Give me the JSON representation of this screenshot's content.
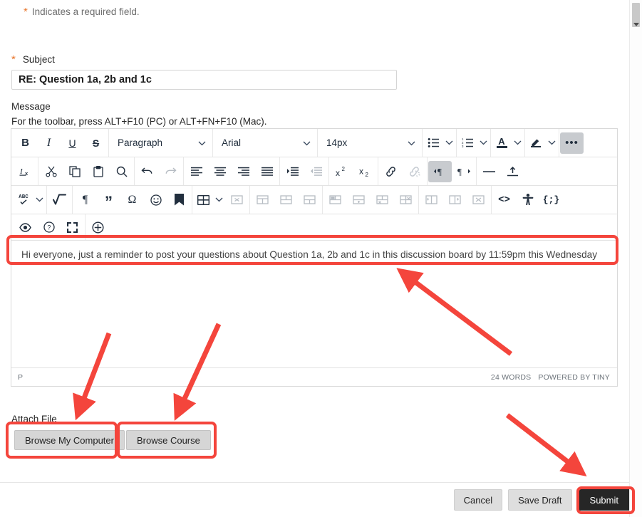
{
  "form": {
    "required_note": "Indicates a required field.",
    "required_marker": "*",
    "subject": {
      "label": "Subject",
      "value": "RE: Question 1a, 2b and 1c",
      "placeholder": "Subject"
    },
    "message": {
      "label": "Message",
      "hint": "For the toolbar, press ALT+F10 (PC) or ALT+FN+F10 (Mac).",
      "body": "Hi everyone, just a reminder to post your questions about Question 1a, 2b and 1c in this discussion board by 11:59pm this Wednesday"
    },
    "attach": {
      "label": "Attach File",
      "browse_my_computer": "Browse My Computer",
      "browse_course": "Browse Course"
    }
  },
  "editor": {
    "selects": {
      "block_format": "Paragraph",
      "font_family": "Arial",
      "font_size": "14px"
    },
    "status": {
      "path": "P",
      "word_count": "24 WORDS",
      "branding": "POWERED BY TINY"
    },
    "toolbar_rows": [
      {
        "groups": [
          {
            "items": [
              {
                "name": "bold-icon",
                "label": "B"
              },
              {
                "name": "italic-icon",
                "label": "I"
              },
              {
                "name": "underline-icon",
                "label": "U"
              },
              {
                "name": "strikethrough-icon",
                "label": "S"
              }
            ]
          },
          {
            "items": [
              {
                "name": "block-format-select",
                "label": "Paragraph"
              }
            ]
          },
          {
            "items": [
              {
                "name": "font-family-select",
                "label": "Arial"
              }
            ]
          },
          {
            "items": [
              {
                "name": "font-size-select",
                "label": "14px"
              }
            ]
          },
          {
            "items": [
              {
                "name": "bullet-list-icon",
                "label": ""
              }
            ]
          },
          {
            "items": [
              {
                "name": "numbered-list-icon",
                "label": ""
              }
            ]
          },
          {
            "items": [
              {
                "name": "text-color-icon",
                "label": "A"
              }
            ]
          },
          {
            "items": [
              {
                "name": "highlight-color-icon",
                "label": ""
              }
            ]
          },
          {
            "items": [
              {
                "name": "more-options-icon",
                "label": "•••"
              }
            ]
          }
        ]
      },
      {
        "groups": [
          {
            "items": [
              {
                "name": "clear-formatting-icon",
                "label": ""
              }
            ]
          },
          {
            "items": [
              {
                "name": "cut-icon",
                "label": ""
              },
              {
                "name": "copy-icon",
                "label": ""
              },
              {
                "name": "paste-icon",
                "label": ""
              },
              {
                "name": "find-replace-icon",
                "label": ""
              }
            ]
          },
          {
            "items": [
              {
                "name": "undo-icon",
                "label": ""
              },
              {
                "name": "redo-icon",
                "label": ""
              }
            ]
          },
          {
            "items": [
              {
                "name": "align-left-icon",
                "label": ""
              },
              {
                "name": "align-center-icon",
                "label": ""
              },
              {
                "name": "align-right-icon",
                "label": ""
              },
              {
                "name": "align-justify-icon",
                "label": ""
              }
            ]
          },
          {
            "items": [
              {
                "name": "indent-increase-icon",
                "label": ""
              },
              {
                "name": "indent-decrease-icon",
                "label": ""
              }
            ]
          },
          {
            "items": [
              {
                "name": "superscript-icon",
                "label": ""
              },
              {
                "name": "subscript-icon",
                "label": ""
              }
            ]
          },
          {
            "items": [
              {
                "name": "insert-link-icon",
                "label": ""
              },
              {
                "name": "unlink-icon",
                "label": ""
              }
            ]
          },
          {
            "items": [
              {
                "name": "ltr-direction-icon",
                "label": ""
              },
              {
                "name": "rtl-direction-icon",
                "label": ""
              }
            ]
          },
          {
            "items": [
              {
                "name": "horizontal-rule-icon",
                "label": ""
              },
              {
                "name": "page-break-icon",
                "label": ""
              }
            ]
          }
        ]
      },
      {
        "groups": [
          {
            "items": [
              {
                "name": "spellcheck-icon",
                "label": "ABC"
              }
            ]
          },
          {
            "items": [
              {
                "name": "math-equation-icon",
                "label": ""
              }
            ]
          },
          {
            "items": [
              {
                "name": "show-invisible-chars-icon",
                "label": "¶"
              },
              {
                "name": "blockquote-icon",
                "label": "”"
              },
              {
                "name": "special-character-icon",
                "label": "Ω"
              },
              {
                "name": "emoji-icon",
                "label": ""
              },
              {
                "name": "anchor-icon",
                "label": ""
              }
            ]
          },
          {
            "items": [
              {
                "name": "insert-table-icon",
                "label": ""
              },
              {
                "name": "delete-table-icon",
                "label": ""
              }
            ]
          },
          {
            "items": [
              {
                "name": "table-properties-icon",
                "label": ""
              },
              {
                "name": "table-cell-properties-icon",
                "label": ""
              },
              {
                "name": "merge-cells-icon",
                "label": ""
              }
            ]
          },
          {
            "items": [
              {
                "name": "insert-row-before-icon",
                "label": ""
              },
              {
                "name": "insert-row-after-icon",
                "label": ""
              },
              {
                "name": "delete-row-icon",
                "label": ""
              },
              {
                "name": "delete-column-icon",
                "label": ""
              }
            ]
          },
          {
            "items": [
              {
                "name": "insert-column-before-icon",
                "label": ""
              },
              {
                "name": "insert-column-after-icon",
                "label": ""
              },
              {
                "name": "delete-table-column-icon",
                "label": ""
              }
            ]
          },
          {
            "items": [
              {
                "name": "source-code-icon",
                "label": "<>"
              },
              {
                "name": "accessibility-checker-icon",
                "label": ""
              },
              {
                "name": "code-sample-icon",
                "label": "{;}"
              }
            ]
          }
        ]
      },
      {
        "groups": [
          {
            "items": [
              {
                "name": "preview-icon",
                "label": ""
              },
              {
                "name": "help-icon",
                "label": "?"
              },
              {
                "name": "fullscreen-icon",
                "label": ""
              }
            ]
          },
          {
            "items": [
              {
                "name": "add-content-icon",
                "label": "+"
              }
            ]
          }
        ]
      }
    ]
  },
  "footer": {
    "cancel": "Cancel",
    "save_draft": "Save Draft",
    "submit": "Submit"
  },
  "colors": {
    "annotation_red": "#f4453c",
    "required_orange": "#e8762c",
    "submit_bg": "#262626",
    "toolbar_icon": "#222f3e"
  }
}
